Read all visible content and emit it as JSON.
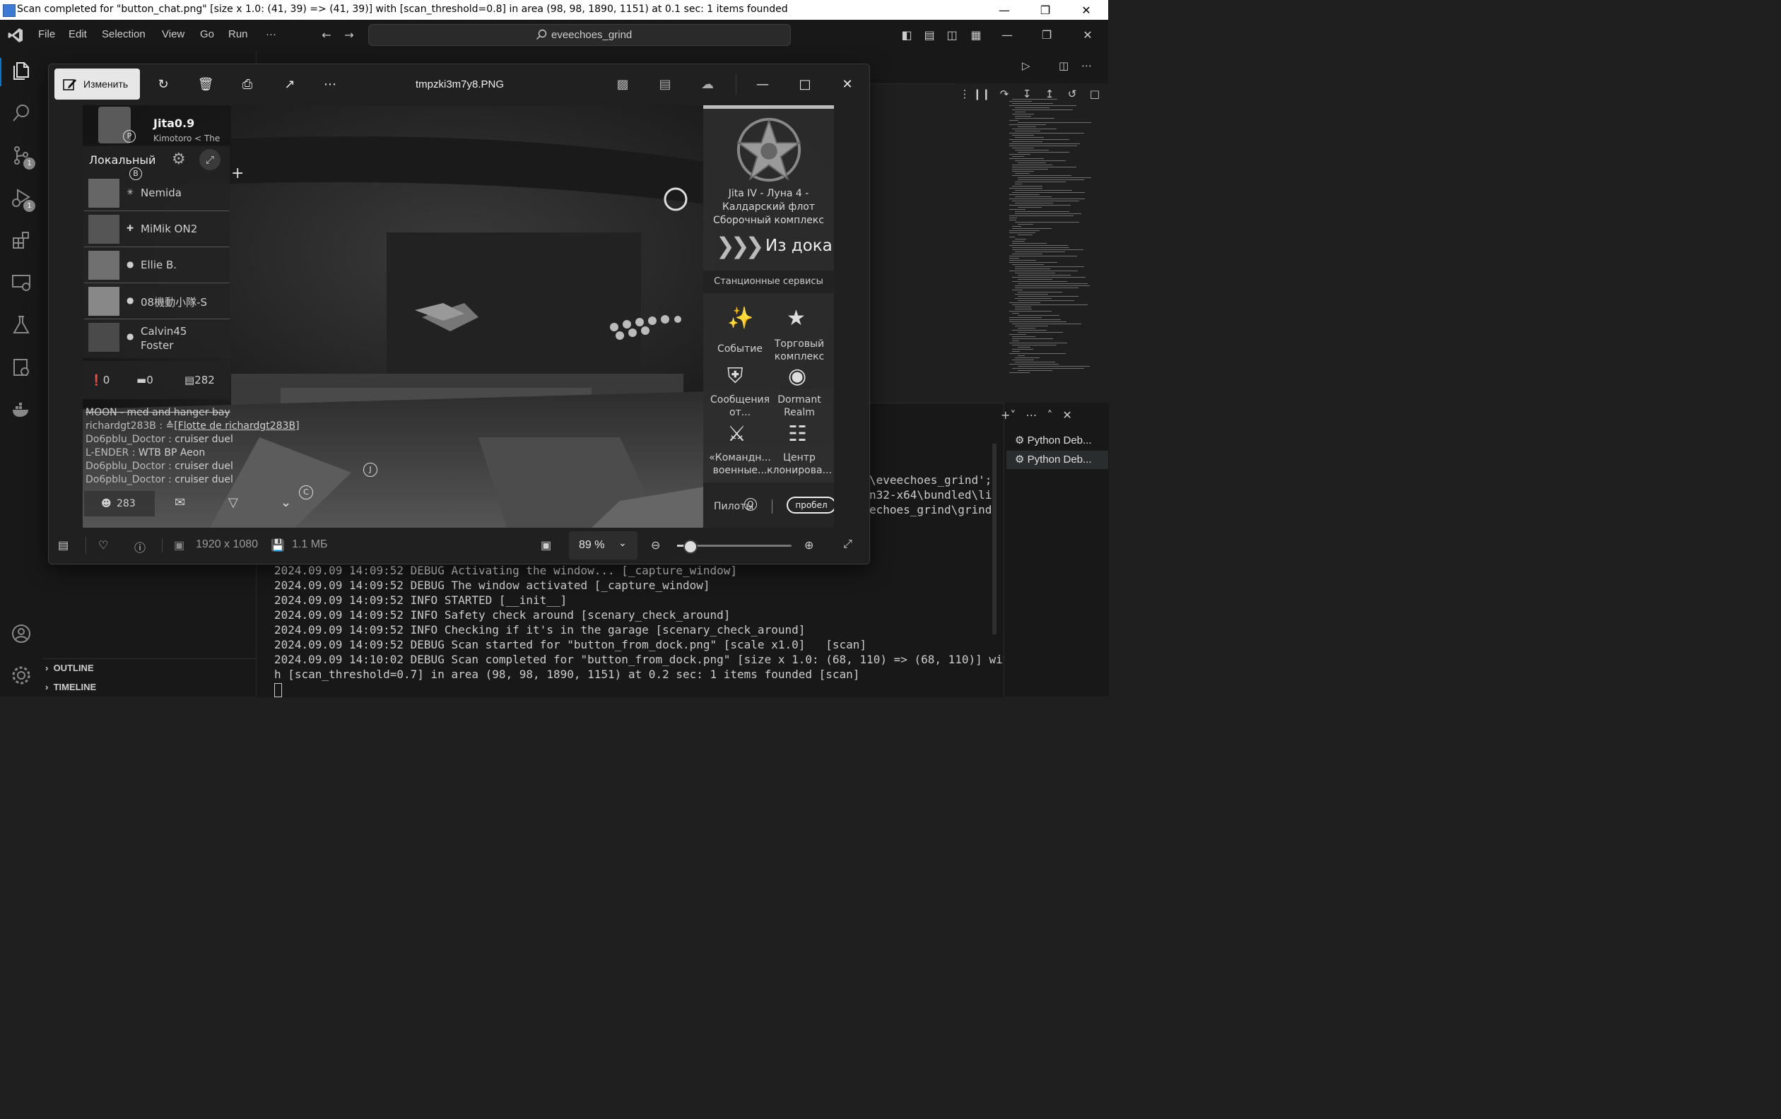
{
  "os_window": {
    "title": "Scan completed for \"button_chat.png\" [size x 1.0: (41, 39) => (41, 39)] with [scan_threshold=0.8] in area (98, 98, 1890, 1151) at 0.1 sec: 1 items founded"
  },
  "vscode": {
    "menu": [
      "File",
      "Edit",
      "Selection",
      "View",
      "Go",
      "Run",
      "···"
    ],
    "search_text": "eveechoes_grind",
    "activity_badges": {
      "source_control": "1",
      "run_debug": "1"
    },
    "sidebar_sections": {
      "outline": "OUTLINE",
      "timeline": "TIMELINE"
    },
    "terminal": {
      "lines": [
        "2024.09.09 14:09:52 DEBUG Activating the window... [_capture_window]",
        "2024.09.09 14:09:52 DEBUG The window activated [_capture_window]",
        "2024.09.09 14:09:52 INFO STARTED [__init__]",
        "2024.09.09 14:09:52 INFO Safety check around [scenary_check_around]",
        "2024.09.09 14:09:52 INFO Checking if it's in the garage [scenary_check_around]",
        "2024.09.09 14:09:52 DEBUG Scan started for \"button_from_dock.png\" [scale x1.0]   [scan]",
        "2024.09.09 14:10:02 DEBUG Scan completed for \"button_from_dock.png\" [size x 1.0: (68, 110) => (68, 110)] wit",
        "h [scan_threshold=0.7] in area (98, 98, 1890, 1151) at 0.2 sec: 1 items founded [scan]"
      ],
      "right_lines": [
        "\\eveechoes_grind';",
        "n32-x64\\bundled\\li",
        "echoes_grind\\grind"
      ],
      "sessions": [
        "Python Deb...",
        "Python Deb..."
      ]
    }
  },
  "viewer": {
    "edit_label": "Изменить",
    "filename": "tmpzki3m7y8.PNG",
    "dimensions": "1920 x 1080",
    "filesize": "1.1 МБ",
    "zoom": "89 %",
    "zoom_level": 0.12
  },
  "game": {
    "player": {
      "name": "Jita",
      "security": "0.9",
      "sub": "Kimotoro < The",
      "p_marker": "P"
    },
    "chat_tab": "Локальный",
    "chat_b_marker": "B",
    "members": [
      "Nemida",
      "MiMik ON2",
      "Ellie B.",
      "08機動小隊-S",
      "Calvin45\nFoster"
    ],
    "counts": {
      "hostile": "0",
      "neutral": "0",
      "total": "282"
    },
    "chat_lines": [
      {
        "name": "MOON - med and hanger bay",
        "msg": ""
      },
      {
        "name": "richardgt283B :",
        "msg": "[Flotte de richardgt283B]"
      },
      {
        "name": "Do6pblu_Doctor :",
        "msg": "cruiser duel"
      },
      {
        "name": "L-ENDER :",
        "msg": "WTB BP Aeon"
      },
      {
        "name": "Do6pblu_Doctor :",
        "msg": "cruiser duel"
      },
      {
        "name": "Do6pblu_Doctor :",
        "msg": "cruiser duel"
      }
    ],
    "bottom_count": "283",
    "markers": {
      "j": "J",
      "c": "C",
      "q": "Q"
    },
    "station": {
      "name": "Jita IV - Луна 4 -\nКалдарский флот\nСборочный комплекс",
      "undock": "Из дока",
      "services_title": "Станционные сервисы",
      "services": [
        {
          "label": "Событие"
        },
        {
          "label": "Торговый\nкомплекс"
        },
        {
          "label": "Сообщения\nот..."
        },
        {
          "label": "Dormant\nRealm"
        },
        {
          "label": "«Командн...\nвоенные..."
        },
        {
          "label": "Центр\nклонирова..."
        }
      ],
      "pilots_label": "Пилоты",
      "space_label": "пробел"
    }
  }
}
